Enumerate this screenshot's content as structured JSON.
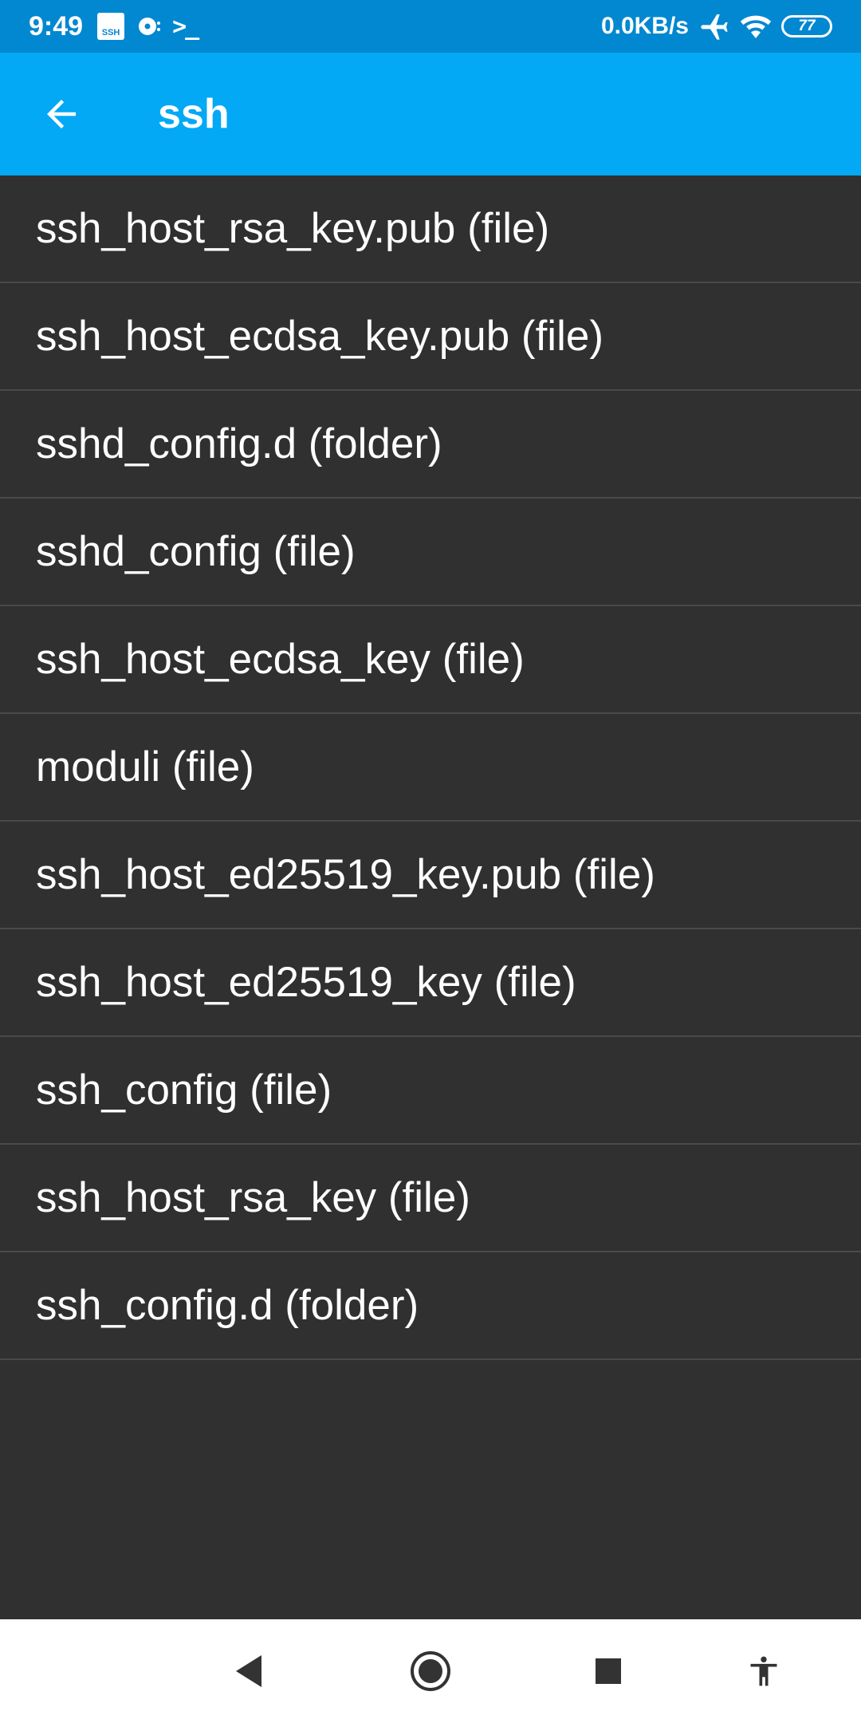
{
  "status_bar": {
    "time": "9:49",
    "ssh_badge": "SSH",
    "network_speed": "0.0KB/s",
    "battery_level": "77",
    "icons": [
      "ssh-notification-icon",
      "disc-icon",
      "terminal-icon",
      "airplane-mode-icon",
      "wifi-icon",
      "battery-icon"
    ]
  },
  "app_bar": {
    "title": "ssh",
    "back_icon": "arrow-back-icon"
  },
  "files": [
    {
      "label": "ssh_host_rsa_key.pub (file)"
    },
    {
      "label": "ssh_host_ecdsa_key.pub (file)"
    },
    {
      "label": "sshd_config.d (folder)"
    },
    {
      "label": "sshd_config (file)"
    },
    {
      "label": "ssh_host_ecdsa_key (file)"
    },
    {
      "label": "moduli (file)"
    },
    {
      "label": "ssh_host_ed25519_key.pub (file)"
    },
    {
      "label": "ssh_host_ed25519_key (file)"
    },
    {
      "label": "ssh_config (file)"
    },
    {
      "label": "ssh_host_rsa_key (file)"
    },
    {
      "label": "ssh_config.d (folder)"
    }
  ],
  "nav_bar": {
    "icons": [
      "nav-back-icon",
      "nav-home-icon",
      "nav-recents-icon",
      "accessibility-icon"
    ]
  },
  "colors": {
    "status_bar_bg": "#0288d1",
    "app_bar_bg": "#03a9f4",
    "list_bg": "#303030",
    "divider": "#4a4a4a",
    "text": "#ffffff"
  }
}
